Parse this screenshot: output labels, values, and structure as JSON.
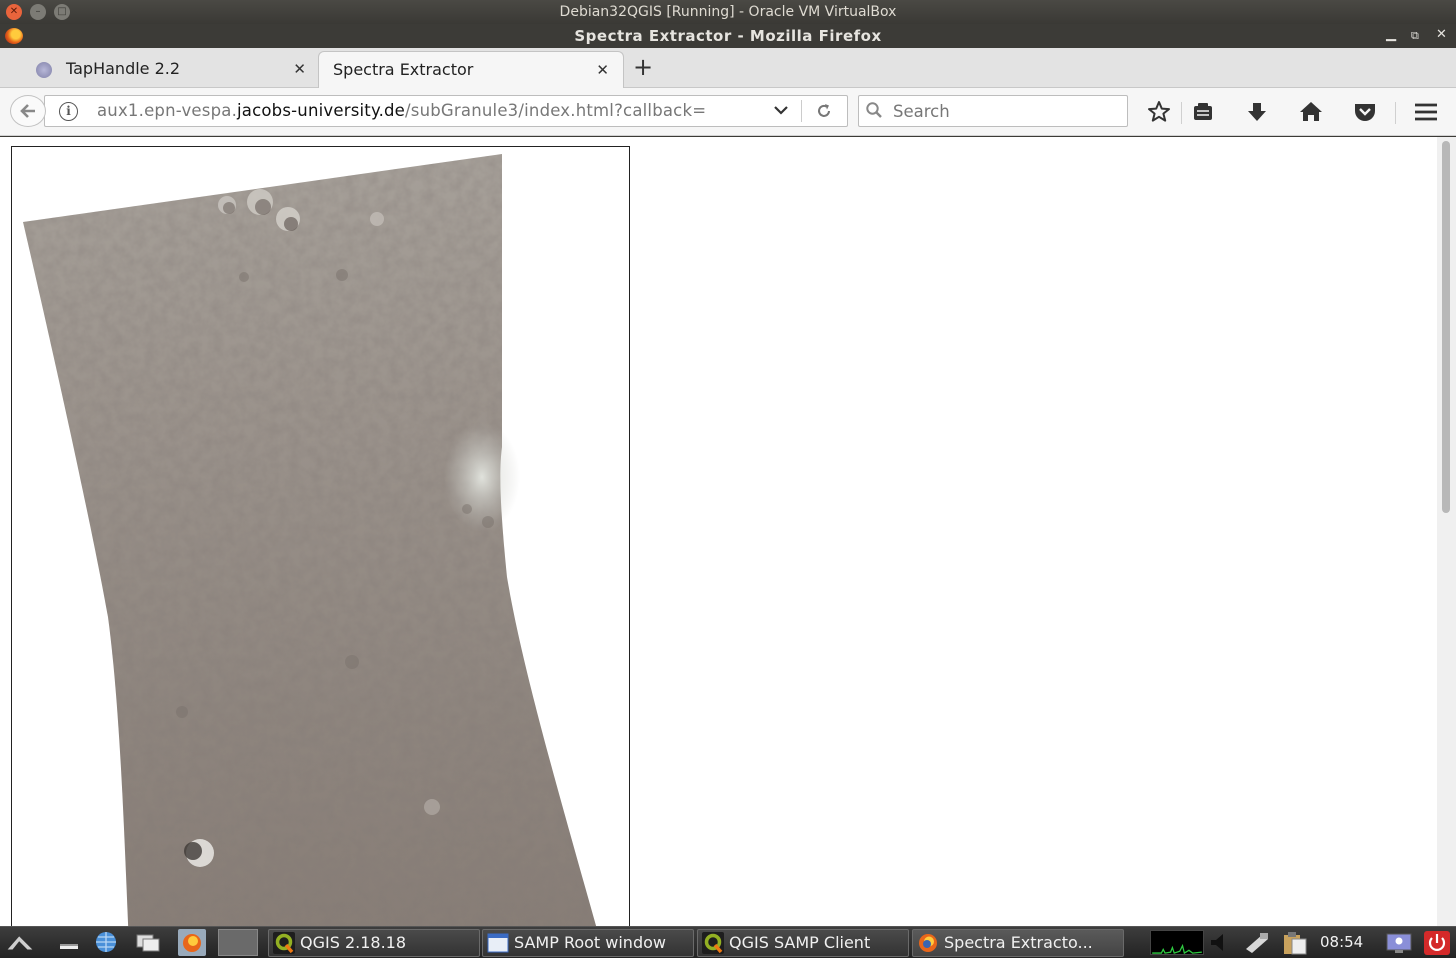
{
  "vbox": {
    "title": "Debian32QGIS [Running] - Oracle VM VirtualBox"
  },
  "firefox": {
    "window_title": "Spectra Extractor - Mozilla Firefox",
    "tabs": [
      {
        "label": "TapHandle 2.2",
        "active": false
      },
      {
        "label": "Spectra Extractor",
        "active": true
      }
    ],
    "url": {
      "prefix": "aux1.epn-vespa.",
      "host": "jacobs-university.de",
      "path": "/subGranule3/index.html?callback="
    },
    "search": {
      "placeholder": "Search",
      "value": ""
    }
  },
  "colors": {
    "accent_close": "#e9643c",
    "taskbar": "#2d2d2d",
    "cpu_graph": "#2ecc40"
  },
  "taskbar": {
    "windows": [
      {
        "label": "QGIS 2.18.18",
        "icon": "qgis-icon"
      },
      {
        "label": "SAMP Root window",
        "icon": "window-icon"
      },
      {
        "label": "QGIS SAMP Client",
        "icon": "qgis-icon"
      },
      {
        "label": "Spectra Extracto...",
        "icon": "firefox-icon"
      }
    ],
    "clock": "08:54"
  }
}
